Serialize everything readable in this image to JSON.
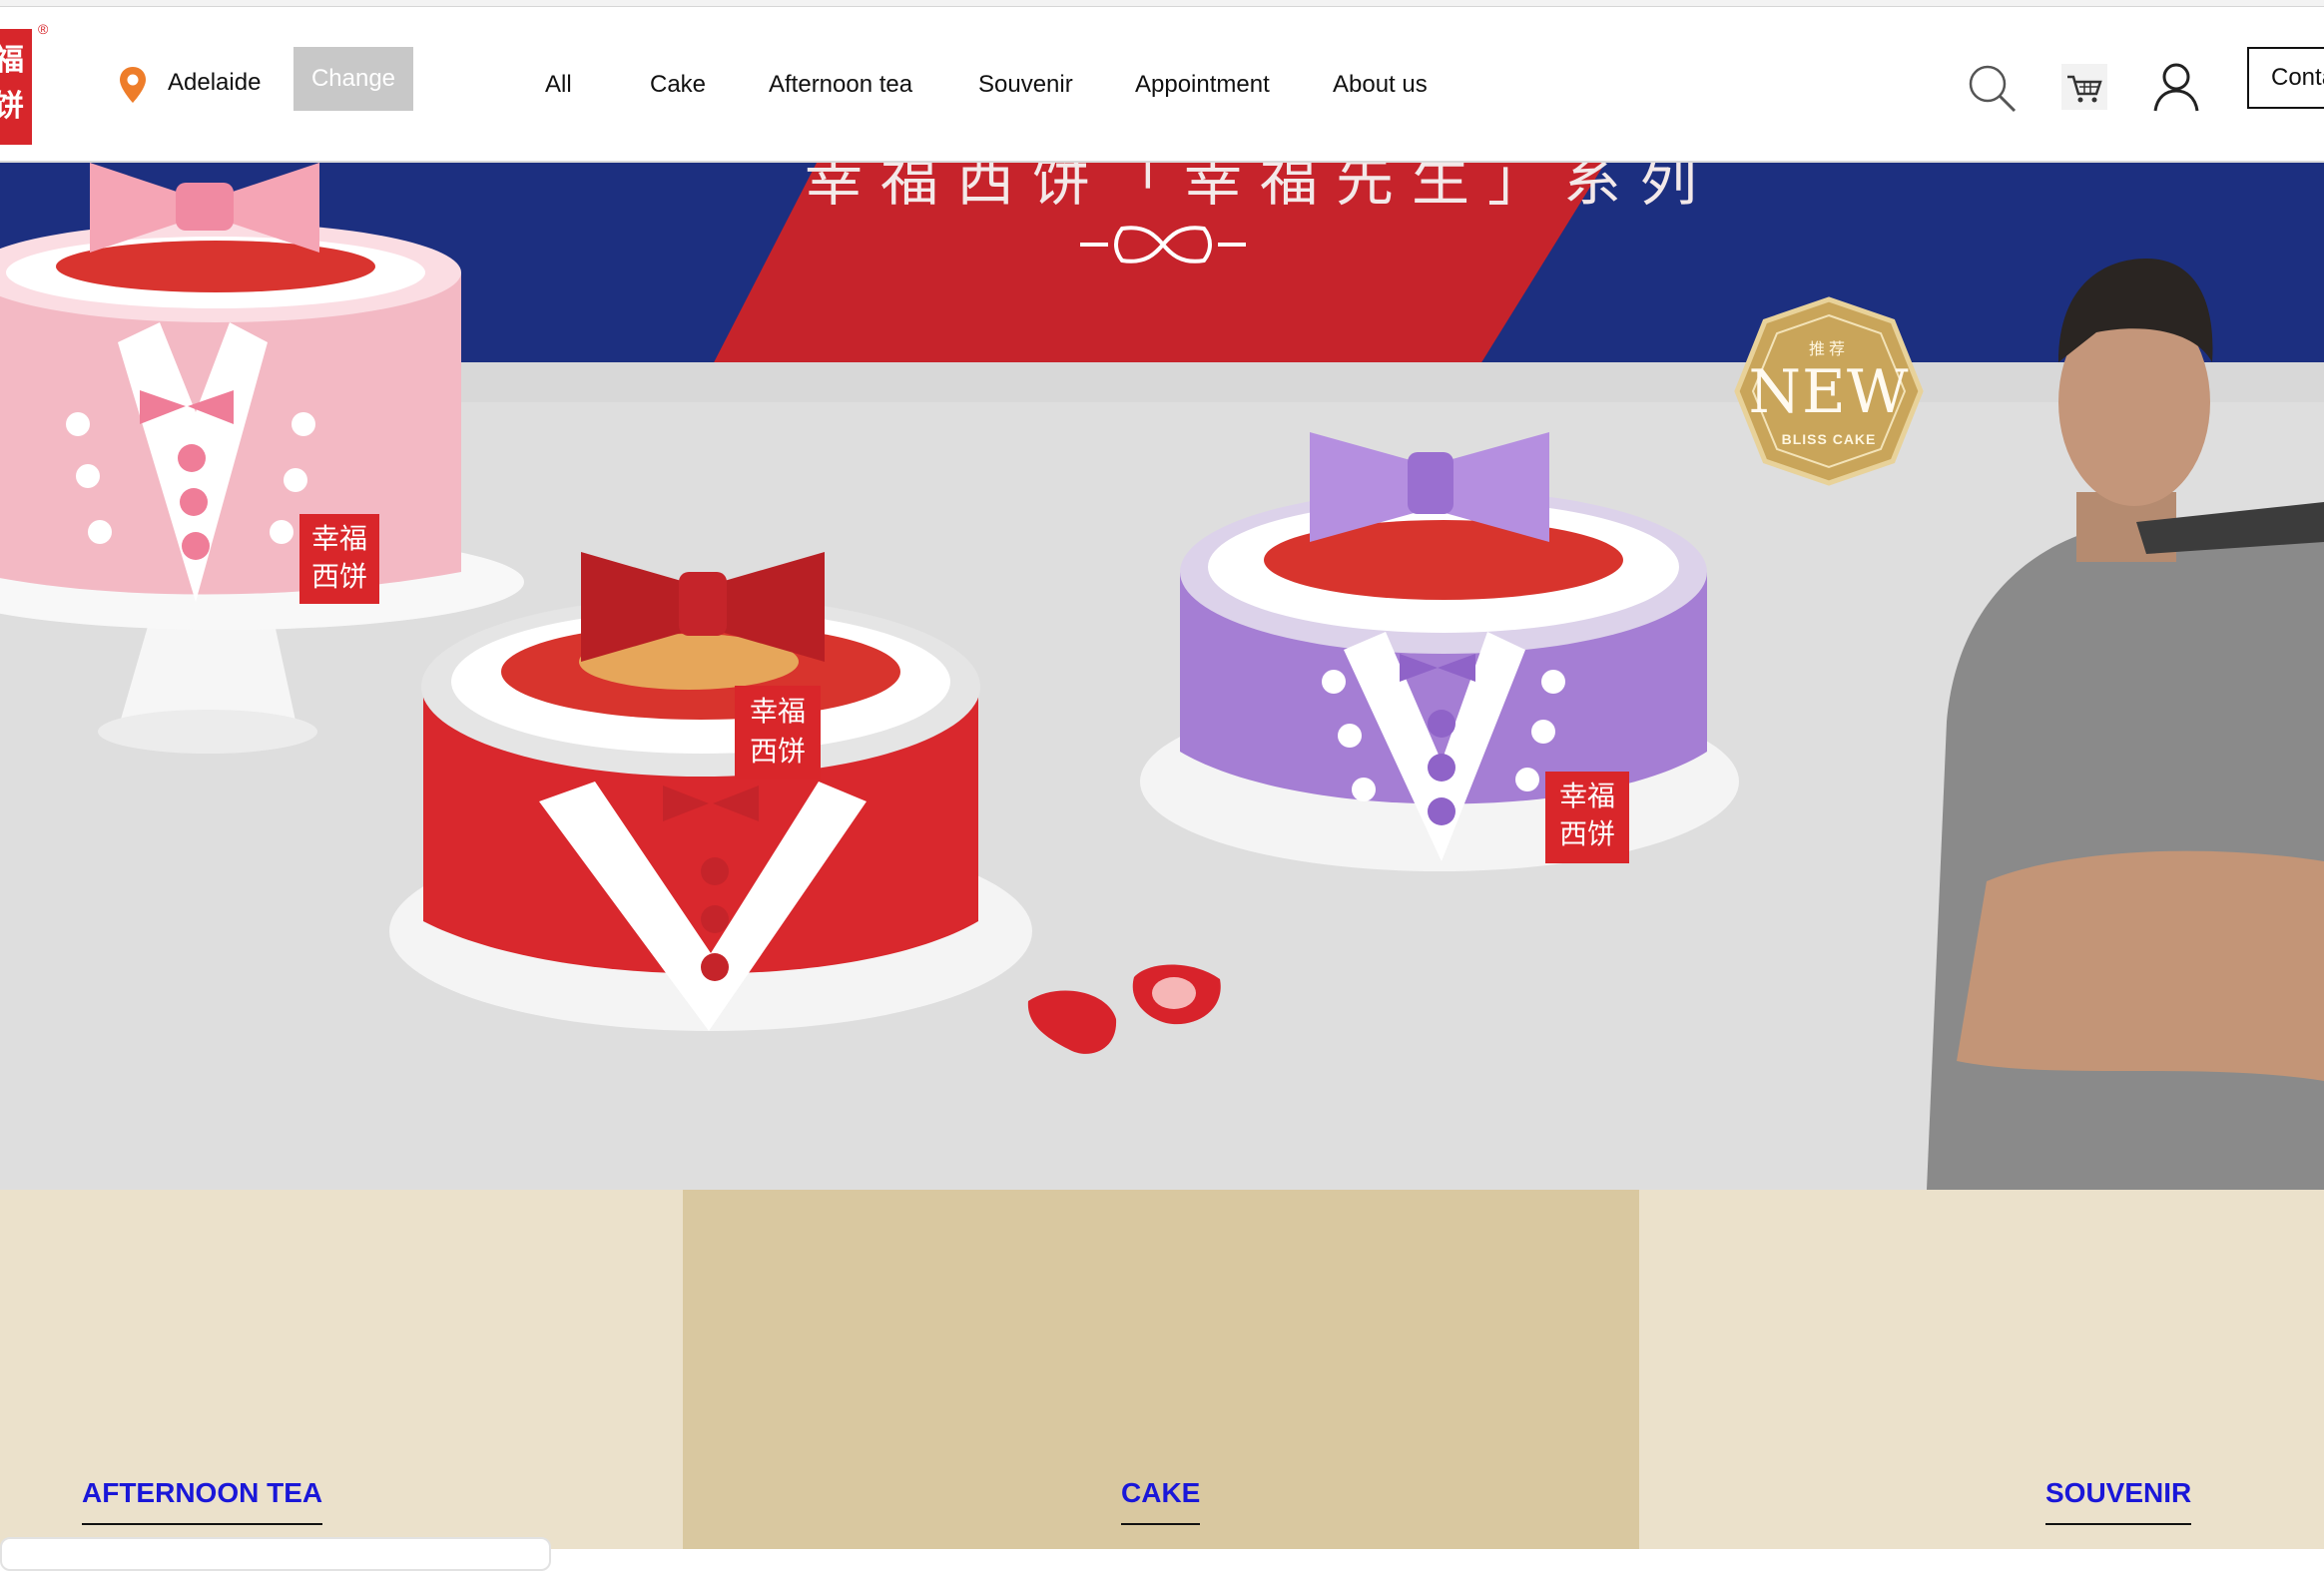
{
  "brand": {
    "logo_text": "幸福西饼",
    "registered_mark": "®",
    "logo_color": "#d7262b"
  },
  "location": {
    "icon": "map-pin-icon",
    "city": "Adelaide",
    "change_label": "Change"
  },
  "nav": {
    "items": [
      "All",
      "Cake",
      "Afternoon tea",
      "Souvenir",
      "Appointment",
      "About us"
    ]
  },
  "header_actions": {
    "icons": [
      "search-icon",
      "cart-icon",
      "user-icon"
    ],
    "contact_label": "Conta"
  },
  "hero": {
    "banner_title": "幸福西饼「幸福先生」系列",
    "badge_top": "推荐",
    "badge_main": "NEW",
    "badge_sub": "BLISS CAKE",
    "cake_tag": "幸福西饼",
    "colors": {
      "navy": "#1c2f80",
      "red": "#c6232b",
      "floor": "#dedede",
      "pink_cake": "#f3b9c4",
      "red_cake": "#d9282d",
      "purple_cake": "#a57ed4",
      "gold_badge": "#c9a55a"
    }
  },
  "categories": [
    {
      "label": "AFTERNOON TEA",
      "bg": "#ebe1cb"
    },
    {
      "label": "CAKE",
      "bg": "#d9c8a0"
    },
    {
      "label": "SOUVENIR",
      "bg": "#ebe1cb"
    }
  ],
  "link_color": "#1a17d8"
}
